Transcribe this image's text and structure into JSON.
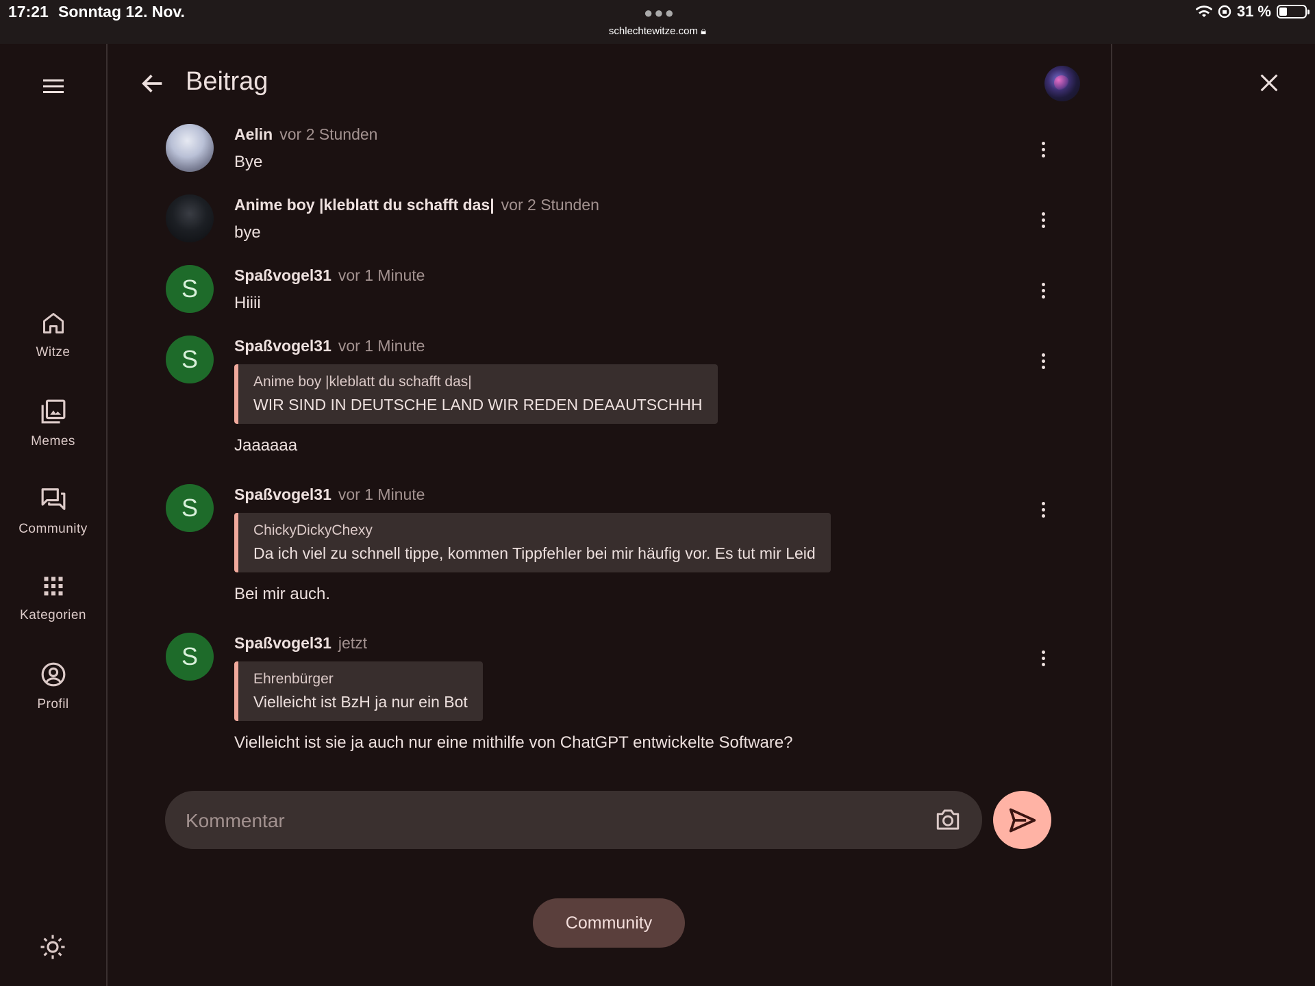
{
  "status_bar": {
    "time": "17:21",
    "date": "Sonntag 12. Nov.",
    "url": "schlechtewitze.com",
    "battery": "31 %"
  },
  "rail": {
    "items": [
      {
        "label": "Witze",
        "icon": "home-icon"
      },
      {
        "label": "Memes",
        "icon": "image-gallery-icon"
      },
      {
        "label": "Community",
        "icon": "forum-icon"
      },
      {
        "label": "Kategorien",
        "icon": "apps-grid-icon"
      },
      {
        "label": "Profil",
        "icon": "account-circle-icon"
      }
    ]
  },
  "header": {
    "title": "Beitrag"
  },
  "comments": [
    {
      "author": "Aelin",
      "time": "vor 2 Stunden",
      "text": "Bye"
    },
    {
      "author": "Anime boy |kleblatt du schafft das|",
      "time": "vor 2 Stunden",
      "text": "bye"
    },
    {
      "author": "Spaßvogel31",
      "avatar_letter": "S",
      "time": "vor 1 Minute",
      "text": "Hiiii"
    },
    {
      "author": "Spaßvogel31",
      "avatar_letter": "S",
      "time": "vor 1 Minute",
      "quote": {
        "author": "Anime boy |kleblatt du schafft das|",
        "text": "WIR SIND IN DEUTSCHE LAND WIR REDEN DEAAUTSCHHH"
      },
      "text": "Jaaaaaa"
    },
    {
      "author": "Spaßvogel31",
      "avatar_letter": "S",
      "time": "vor 1 Minute",
      "quote": {
        "author": "ChickyDickyChexy",
        "text": "Da ich viel zu schnell tippe, kommen Tippfehler bei mir häufig vor. Es tut mir Leid"
      },
      "text": "Bei mir auch."
    },
    {
      "author": "Spaßvogel31",
      "avatar_letter": "S",
      "time": "jetzt",
      "quote": {
        "author": "Ehrenbürger",
        "text": "Vielleicht ist BzH ja nur ein Bot"
      },
      "text": "Vielleicht ist sie ja auch nur eine mithilfe von ChatGPT entwickelte Software?"
    }
  ],
  "composer": {
    "placeholder": "Kommentar",
    "value": ""
  },
  "footer_button": "Community",
  "colors": {
    "accent": "#ffb3a5",
    "quote_border": "#f0a99c",
    "avatar_green": "#1e6b2a",
    "background": "#1b1111"
  }
}
